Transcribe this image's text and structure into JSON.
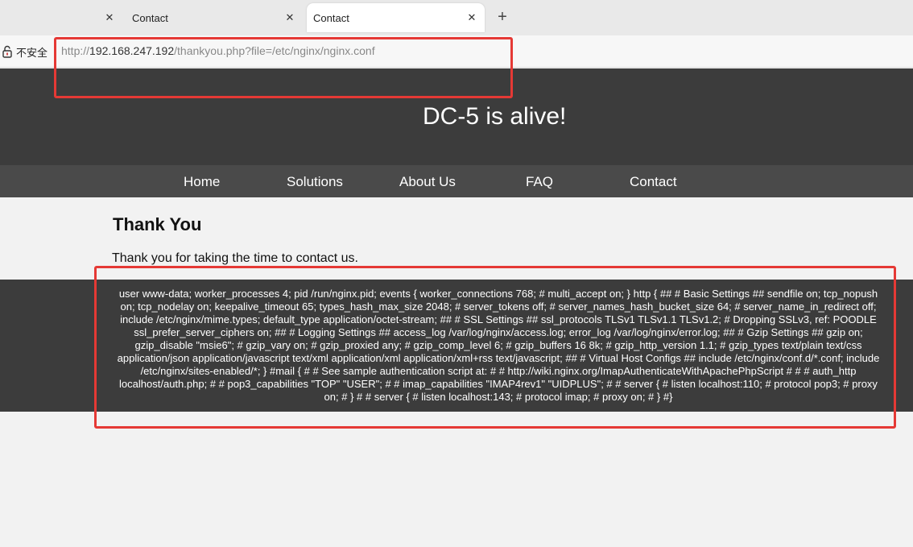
{
  "browser": {
    "tabs": [
      {
        "title": "Contact",
        "active": false
      },
      {
        "title": "Contact",
        "active": true
      }
    ],
    "new_tab": "+",
    "close": "✕",
    "security_label": "不安全",
    "url_scheme": "http://",
    "url_host": "192.168.247.192",
    "url_path": "/thankyou.php?file=/etc/nginx/nginx.conf"
  },
  "site": {
    "title": "DC-5 is alive!",
    "nav": [
      "Home",
      "Solutions",
      "About Us",
      "FAQ",
      "Contact"
    ]
  },
  "content": {
    "heading": "Thank You",
    "message": "Thank you for taking the time to contact us.",
    "file_dump": "user www-data; worker_processes 4; pid /run/nginx.pid; events { worker_connections 768; # multi_accept on; } http { ## # Basic Settings ## sendfile on; tcp_nopush on; tcp_nodelay on; keepalive_timeout 65; types_hash_max_size 2048; # server_tokens off; # server_names_hash_bucket_size 64; # server_name_in_redirect off; include /etc/nginx/mime.types; default_type application/octet-stream; ## # SSL Settings ## ssl_protocols TLSv1 TLSv1.1 TLSv1.2; # Dropping SSLv3, ref: POODLE ssl_prefer_server_ciphers on; ## # Logging Settings ## access_log /var/log/nginx/access.log; error_log /var/log/nginx/error.log; ## # Gzip Settings ## gzip on; gzip_disable \"msie6\"; # gzip_vary on; # gzip_proxied any; # gzip_comp_level 6; # gzip_buffers 16 8k; # gzip_http_version 1.1; # gzip_types text/plain text/css application/json application/javascript text/xml application/xml application/xml+rss text/javascript; ## # Virtual Host Configs ## include /etc/nginx/conf.d/*.conf; include /etc/nginx/sites-enabled/*; } #mail { # # See sample authentication script at: # # http://wiki.nginx.org/ImapAuthenticateWithApachePhpScript # # # auth_http localhost/auth.php; # # pop3_capabilities \"TOP\" \"USER\"; # # imap_capabilities \"IMAP4rev1\" \"UIDPLUS\"; # # server { # listen localhost:110; # protocol pop3; # proxy on; # } # # server { # listen localhost:143; # protocol imap; # proxy on; # } #}"
  },
  "colors": {
    "header_bg": "#3c3c3c",
    "nav_bg": "#4a4a4a",
    "page_bg": "#f2f2f2",
    "highlight": "#e53935"
  }
}
